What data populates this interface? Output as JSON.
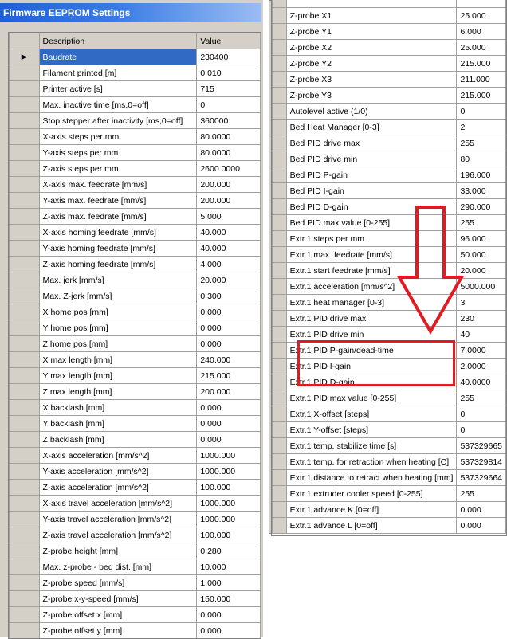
{
  "window": {
    "title": "Firmware EEPROM Settings"
  },
  "grid": {
    "columns": [
      "Description",
      "Value"
    ],
    "selected_indicator": "▶",
    "left_rows": [
      [
        "Baudrate",
        "230400"
      ],
      [
        "Filament printed [m]",
        "0.010"
      ],
      [
        "Printer active [s]",
        "715"
      ],
      [
        "Max. inactive time [ms,0=off]",
        "0"
      ],
      [
        "Stop stepper after inactivity [ms,0=off]",
        "360000"
      ],
      [
        "X-axis steps per mm",
        "80.0000"
      ],
      [
        "Y-axis steps per mm",
        "80.0000"
      ],
      [
        "Z-axis steps per mm",
        "2600.0000"
      ],
      [
        "X-axis max. feedrate [mm/s]",
        "200.000"
      ],
      [
        "Y-axis max. feedrate [mm/s]",
        "200.000"
      ],
      [
        "Z-axis max. feedrate [mm/s]",
        "5.000"
      ],
      [
        "X-axis homing feedrate [mm/s]",
        "40.000"
      ],
      [
        "Y-axis homing feedrate [mm/s]",
        "40.000"
      ],
      [
        "Z-axis homing feedrate [mm/s]",
        "4.000"
      ],
      [
        "Max. jerk [mm/s]",
        "20.000"
      ],
      [
        "Max. Z-jerk [mm/s]",
        "0.300"
      ],
      [
        "X home pos [mm]",
        "0.000"
      ],
      [
        "Y home pos [mm]",
        "0.000"
      ],
      [
        "Z home pos [mm]",
        "0.000"
      ],
      [
        "X max length [mm]",
        "240.000"
      ],
      [
        "Y max length [mm]",
        "215.000"
      ],
      [
        "Z max length [mm]",
        "200.000"
      ],
      [
        "X backlash [mm]",
        "0.000"
      ],
      [
        "Y backlash [mm]",
        "0.000"
      ],
      [
        "Z backlash [mm]",
        "0.000"
      ],
      [
        "X-axis acceleration [mm/s^2]",
        "1000.000"
      ],
      [
        "Y-axis acceleration [mm/s^2]",
        "1000.000"
      ],
      [
        "Z-axis acceleration [mm/s^2]",
        "100.000"
      ],
      [
        "X-axis travel acceleration [mm/s^2]",
        "1000.000"
      ],
      [
        "Y-axis travel acceleration [mm/s^2]",
        "1000.000"
      ],
      [
        "Z-axis travel acceleration [mm/s^2]",
        "100.000"
      ],
      [
        "Z-probe height [mm]",
        "0.280"
      ],
      [
        "Max. z-probe - bed dist. [mm]",
        "10.000"
      ],
      [
        "Z-probe speed [mm/s]",
        "1.000"
      ],
      [
        "Z-probe x-y-speed [mm/s]",
        "150.000"
      ],
      [
        "Z-probe offset x [mm]",
        "0.000"
      ],
      [
        "Z-probe offset y [mm]",
        "0.000"
      ]
    ],
    "right_rows": [
      [
        "",
        ""
      ],
      [
        "Z-probe X1",
        "25.000"
      ],
      [
        "Z-probe Y1",
        "6.000"
      ],
      [
        "Z-probe X2",
        "25.000"
      ],
      [
        "Z-probe Y2",
        "215.000"
      ],
      [
        "Z-probe X3",
        "211.000"
      ],
      [
        "Z-probe Y3",
        "215.000"
      ],
      [
        "Autolevel active (1/0)",
        "0"
      ],
      [
        "Bed Heat Manager [0-3]",
        "2"
      ],
      [
        "Bed PID drive max",
        "255"
      ],
      [
        "Bed PID drive min",
        "80"
      ],
      [
        "Bed PID P-gain",
        "196.000"
      ],
      [
        "Bed PID I-gain",
        "33.000"
      ],
      [
        "Bed PID D-gain",
        "290.000"
      ],
      [
        "Bed PID max value [0-255]",
        "255"
      ],
      [
        "Extr.1 steps per mm",
        "96.000"
      ],
      [
        "Extr.1 max. feedrate [mm/s]",
        "50.000"
      ],
      [
        "Extr.1 start feedrate [mm/s]",
        "20.000"
      ],
      [
        "Extr.1 acceleration [mm/s^2]",
        "5000.000"
      ],
      [
        "Extr.1 heat manager [0-3]",
        "3"
      ],
      [
        "Extr.1 PID drive max",
        "230"
      ],
      [
        "Extr.1 PID drive min",
        "40"
      ],
      [
        "Extr.1 PID P-gain/dead-time",
        "7.0000"
      ],
      [
        "Extr.1 PID I-gain",
        "2.0000"
      ],
      [
        "Extr.1 PID D-gain",
        "40.0000"
      ],
      [
        "Extr.1 PID max value [0-255]",
        "255"
      ],
      [
        "Extr.1 X-offset [steps]",
        "0"
      ],
      [
        "Extr.1 Y-offset [steps]",
        "0"
      ],
      [
        "Extr.1 temp. stabilize time [s]",
        "537329665"
      ],
      [
        "Extr.1 temp. for retraction when heating [C]",
        "537329814"
      ],
      [
        "Extr.1 distance to retract when heating [mm]",
        "537329664"
      ],
      [
        "Extr.1 extruder cooler speed [0-255]",
        "255"
      ],
      [
        "Extr.1 advance K [0=off]",
        "0.000"
      ],
      [
        "Extr.1 advance L [0=off]",
        "0.000"
      ]
    ]
  },
  "annotation": {
    "color": "#e01b24"
  },
  "colors": {
    "selection": "#316ac5",
    "titlebar": "#1f5fd6"
  }
}
